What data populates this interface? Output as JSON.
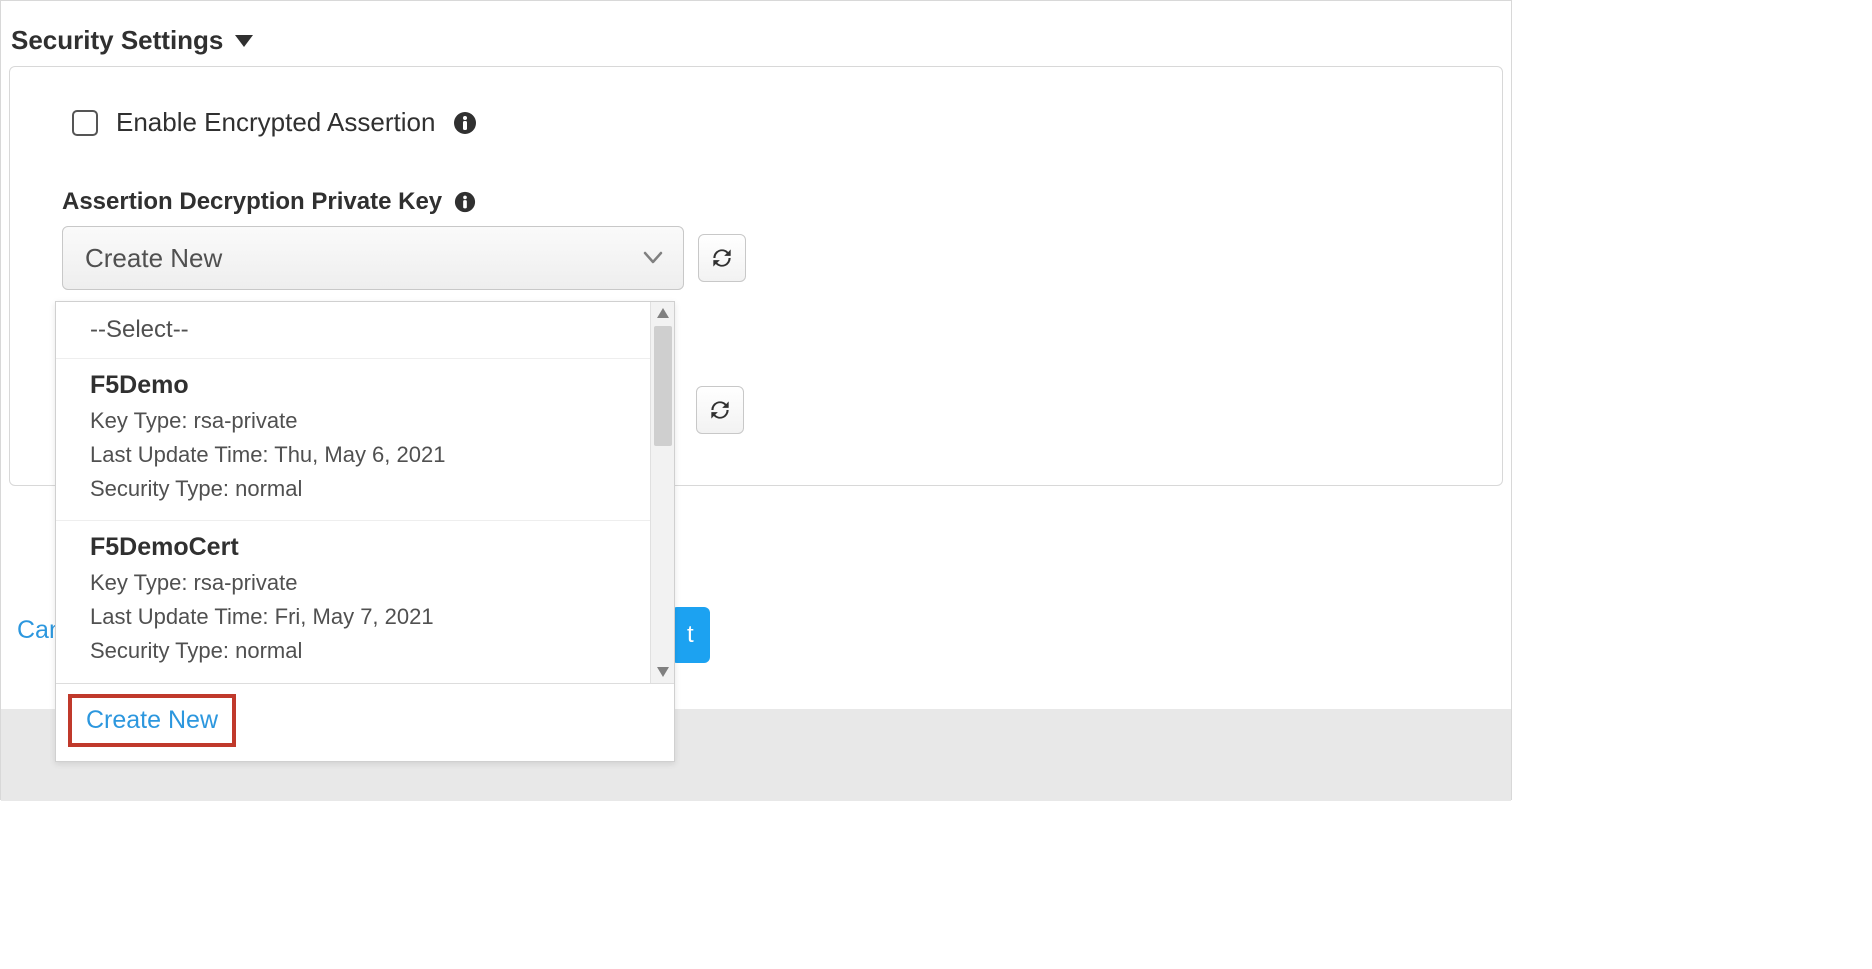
{
  "section": {
    "title": "Security Settings"
  },
  "checkbox": {
    "label": "Enable Encrypted Assertion"
  },
  "field": {
    "label": "Assertion Decryption Private Key",
    "selected": "Create New"
  },
  "dropdown": {
    "placeholder": "--Select--",
    "items": [
      {
        "name": "F5Demo",
        "keyType": "Key Type: rsa-private",
        "lastUpdate": "Last Update Time: Thu, May 6, 2021",
        "securityType": "Security Type: normal"
      },
      {
        "name": "F5DemoCert",
        "keyType": "Key Type: rsa-private",
        "lastUpdate": "Last Update Time: Fri, May 7, 2021",
        "securityType": "Security Type: normal"
      }
    ],
    "createNew": "Create New"
  },
  "footer": {
    "cancel": "Can",
    "saveNext": "t"
  }
}
